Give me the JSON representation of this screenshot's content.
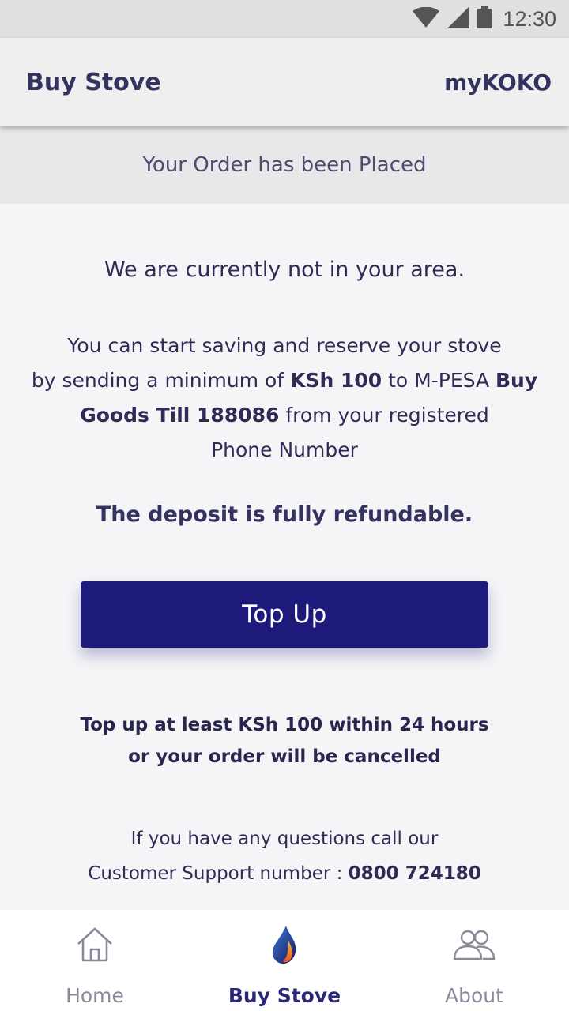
{
  "status_bar": {
    "time": "12:30",
    "icons": [
      "wifi-icon",
      "signal-icon",
      "battery-icon"
    ]
  },
  "app_bar": {
    "title": "Buy Stove",
    "brand": "myKOKO"
  },
  "banner": {
    "text": "Your Order has been Placed"
  },
  "main": {
    "not_in_area": "We are currently not in your area.",
    "instr_line1": "You can start saving and reserve your stove",
    "instr_line2_a": "by sending a minimum of ",
    "instr_amount": "KSh 100",
    "instr_line2_b": " to M-PESA ",
    "instr_buy": "Buy",
    "instr_till": "Goods Till 188086",
    "instr_line3_b": " from your registered",
    "instr_line4": "Phone Number",
    "refundable": "The deposit is fully refundable.",
    "topup_label": "Top Up",
    "warning_line1": "Top up at least KSh 100 within 24 hours",
    "warning_line2": "or your order will be cancelled",
    "support_line1": "If you have any questions call our",
    "support_line2_a": "Customer Support number : ",
    "support_number": "0800 724180"
  },
  "bottom_nav": {
    "items": [
      {
        "label": "Home",
        "icon": "home-icon",
        "active": false
      },
      {
        "label": "Buy Stove",
        "icon": "flame-icon",
        "active": true
      },
      {
        "label": "About",
        "icon": "people-icon",
        "active": false
      }
    ]
  },
  "colors": {
    "primary": "#1d1a7c",
    "text": "#2e2c55",
    "inactive": "#8a8899"
  }
}
